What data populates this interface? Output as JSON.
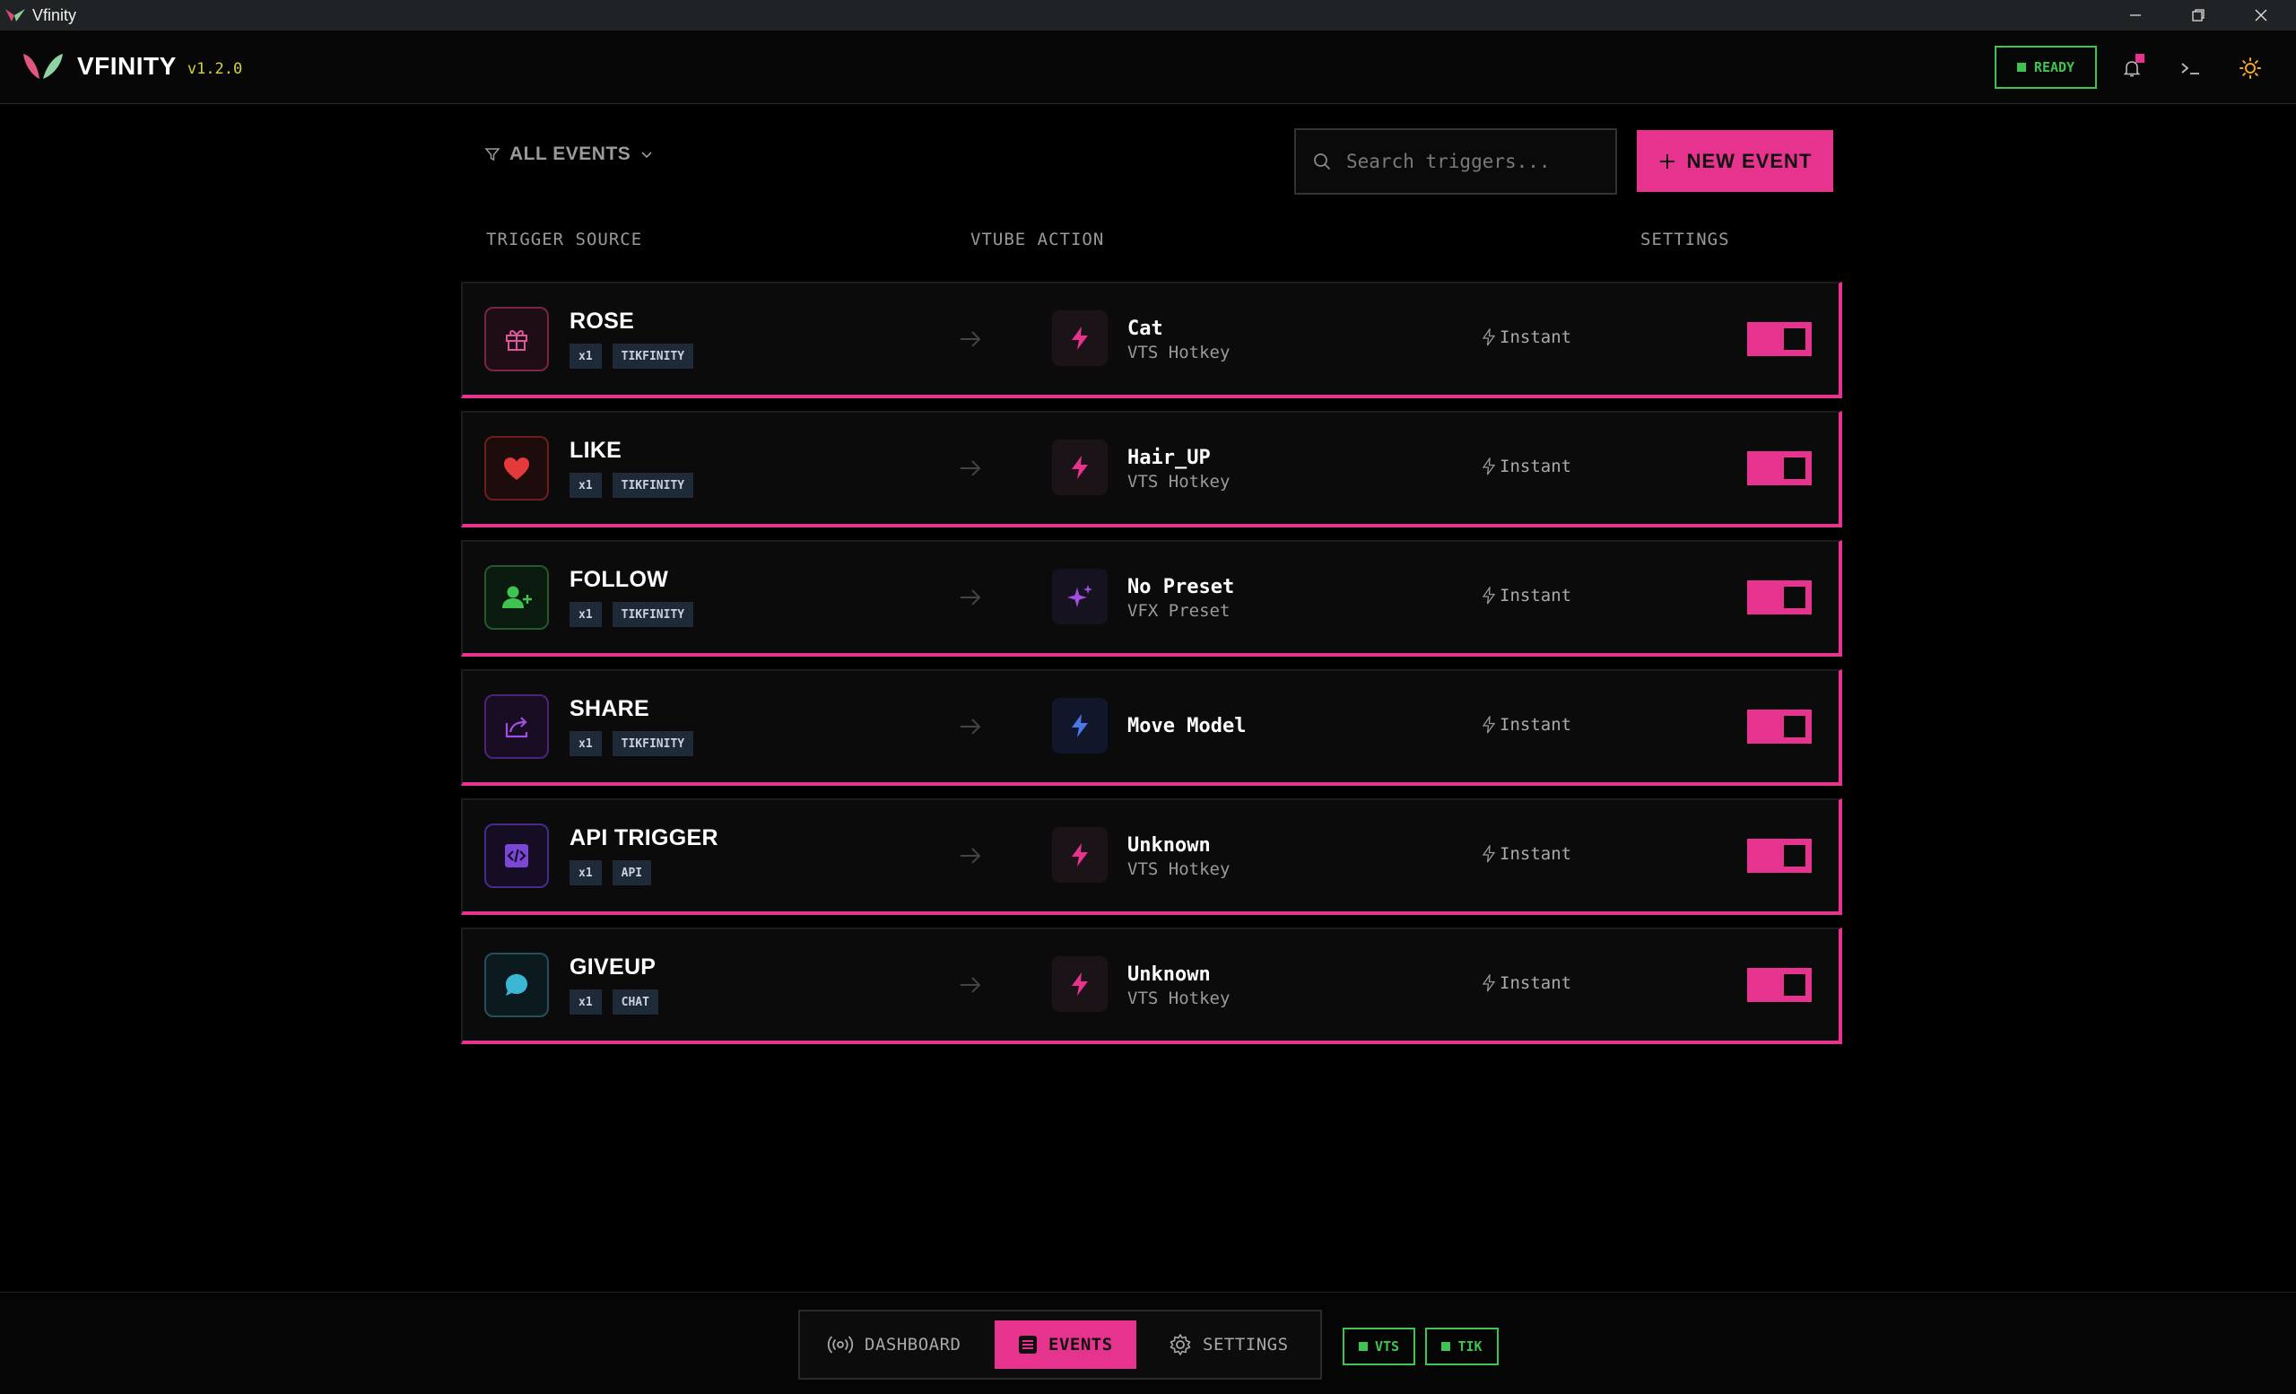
{
  "window": {
    "title": "Vfinity"
  },
  "header": {
    "brand": "VFINITY",
    "version": "v1.2.0",
    "status": "READY"
  },
  "toolbar": {
    "filter_label": "ALL EVENTS",
    "search_placeholder": "Search triggers...",
    "new_event_label": "NEW EVENT"
  },
  "columns": {
    "trigger_source": "TRIGGER SOURCE",
    "vtube_action": "VTUBE ACTION",
    "settings": "SETTINGS"
  },
  "colors": {
    "accent": "#e6338e",
    "ok": "#3ec451",
    "version": "#d8d23a"
  },
  "events": [
    {
      "name": "ROSE",
      "count": "x1",
      "source": "TIKFINITY",
      "icon": "gift-icon",
      "action": "Cat",
      "action_type": "VTS Hotkey",
      "action_icon": "bolt-icon",
      "timing": "Instant",
      "enabled": true
    },
    {
      "name": "LIKE",
      "count": "x1",
      "source": "TIKFINITY",
      "icon": "heart-icon",
      "action": "Hair_UP",
      "action_type": "VTS Hotkey",
      "action_icon": "bolt-icon",
      "timing": "Instant",
      "enabled": true
    },
    {
      "name": "FOLLOW",
      "count": "x1",
      "source": "TIKFINITY",
      "icon": "user-plus-icon",
      "action": "No Preset",
      "action_type": "VFX Preset",
      "action_icon": "sparkles-icon",
      "timing": "Instant",
      "enabled": true
    },
    {
      "name": "SHARE",
      "count": "x1",
      "source": "TIKFINITY",
      "icon": "share-icon",
      "action": "Move Model",
      "action_type": "",
      "action_icon": "bolt-icon",
      "timing": "Instant",
      "enabled": true
    },
    {
      "name": "API TRIGGER",
      "count": "x1",
      "source": "API",
      "icon": "code-icon",
      "action": "Unknown",
      "action_type": "VTS Hotkey",
      "action_icon": "bolt-icon",
      "timing": "Instant",
      "enabled": true
    },
    {
      "name": "GIVEUP",
      "count": "x1",
      "source": "CHAT",
      "icon": "chat-icon",
      "action": "Unknown",
      "action_type": "VTS Hotkey",
      "action_icon": "bolt-icon",
      "timing": "Instant",
      "enabled": true
    }
  ],
  "nav": {
    "dashboard": "DASHBOARD",
    "events": "EVENTS",
    "settings": "SETTINGS",
    "active": "EVENTS"
  },
  "connections": {
    "vts": "VTS",
    "tik": "TIK"
  }
}
